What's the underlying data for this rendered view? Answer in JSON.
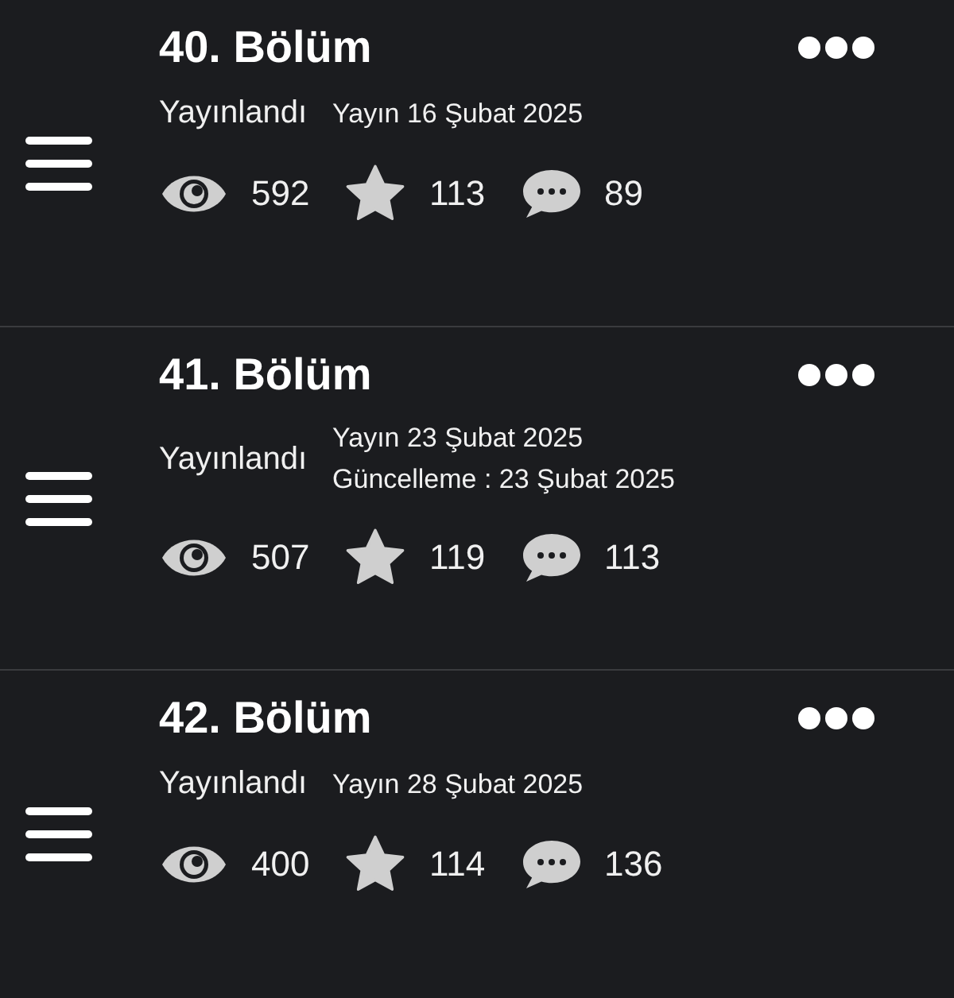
{
  "episodes": [
    {
      "title": "40. Bölüm",
      "status": "Yayınlandı",
      "dates": [
        "Yayın 16 Şubat 2025"
      ],
      "views": "592",
      "stars": "113",
      "comments": "89"
    },
    {
      "title": "41. Bölüm",
      "status": "Yayınlandı",
      "dates": [
        "Yayın 23 Şubat 2025",
        "Güncelleme : 23 Şubat 2025"
      ],
      "views": "507",
      "stars": "119",
      "comments": "113"
    },
    {
      "title": "42. Bölüm",
      "status": "Yayınlandı",
      "dates": [
        "Yayın 28 Şubat 2025"
      ],
      "views": "400",
      "stars": "114",
      "comments": "136"
    }
  ]
}
